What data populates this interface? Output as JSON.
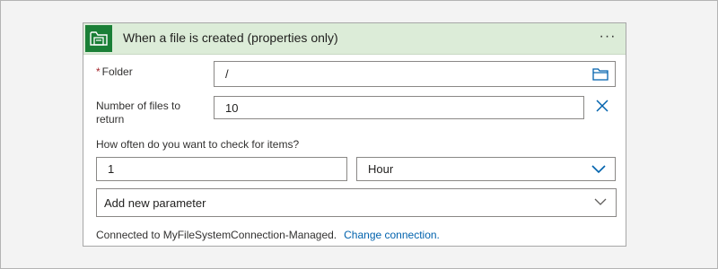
{
  "trigger": {
    "title": "When a file is created (properties only)",
    "more_label": "···",
    "icon": "file-system-connector-icon",
    "brand_color": "#1a7f36",
    "header_bg": "#dcecd8"
  },
  "fields": {
    "folder": {
      "required_mark": "*",
      "label": "Folder",
      "value": "/",
      "icon": "folder-picker-icon"
    },
    "num_files": {
      "label": "Number of files to return",
      "value": "10",
      "remove_icon": "close-icon"
    },
    "frequency": {
      "label": "How often do you want to check for items?",
      "interval_value": "1",
      "unit_value": "Hour",
      "unit_icon": "chevron-down-icon"
    },
    "add_param": {
      "label": "Add new parameter",
      "icon": "chevron-down-icon"
    }
  },
  "footer": {
    "connected_text": "Connected to MyFileSystemConnection-Managed.",
    "change_link": "Change connection."
  }
}
